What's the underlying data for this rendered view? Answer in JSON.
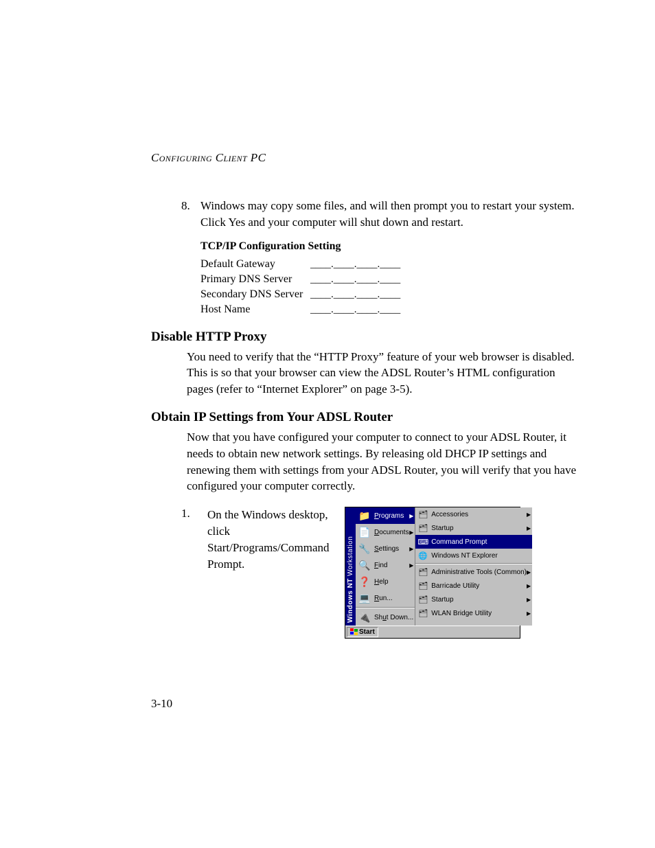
{
  "running_header": "Configuring Client PC",
  "step8": {
    "num": "8.",
    "text": "Windows may copy some files, and will then prompt you to restart your system. Click Yes and your computer will shut down and restart."
  },
  "settings_table": {
    "header": "TCP/IP Configuration Setting",
    "rows": [
      {
        "label": "Default Gateway",
        "value": "____.____.____.____"
      },
      {
        "label": "Primary DNS Server",
        "value": "____.____.____.____"
      },
      {
        "label": "Secondary DNS Server",
        "value": "____.____.____.____"
      },
      {
        "label": "Host Name",
        "value": "____.____.____.____"
      }
    ]
  },
  "section_proxy": {
    "heading": "Disable HTTP Proxy",
    "body": "You need to verify that the “HTTP Proxy” feature of your web browser is disabled. This is so that your browser can view the ADSL Router’s HTML configuration pages (refer to “Internet Explorer” on page 3-5)."
  },
  "section_obtain": {
    "heading": "Obtain IP Settings from Your ADSL Router",
    "body": "Now that you have configured your computer to connect to your ADSL Router, it needs to obtain new network settings. By releasing old DHCP IP settings and renewing them with settings from your ADSL Router, you will verify that you have configured your computer correctly."
  },
  "step1": {
    "num": "1.",
    "text": "On the Windows desktop, click Start/Programs/Command Prompt."
  },
  "start_menu": {
    "banner_bold": "Windows NT",
    "banner_light": "Workstation",
    "main": [
      {
        "icon": "📁",
        "label": "Programs",
        "u": "P",
        "arrow": true,
        "selected": true
      },
      {
        "icon": "📄",
        "label": "Documents",
        "u": "D",
        "arrow": true
      },
      {
        "icon": "🔧",
        "label": "Settings",
        "u": "S",
        "arrow": true
      },
      {
        "icon": "🔍",
        "label": "Find",
        "u": "F",
        "arrow": true
      },
      {
        "icon": "❓",
        "label": "Help",
        "u": "H",
        "arrow": false
      },
      {
        "icon": "💻",
        "label": "Run...",
        "u": "R",
        "arrow": false
      },
      {
        "sep": true
      },
      {
        "icon": "🔌",
        "label": "Shut Down...",
        "u": "u",
        "arrow": false
      }
    ],
    "sub": [
      {
        "icon": "🗂",
        "label": "Accessories",
        "arrow": true
      },
      {
        "icon": "🗂",
        "label": "Startup",
        "arrow": true
      },
      {
        "icon": "⌨",
        "label": "Command Prompt",
        "selected": true
      },
      {
        "icon": "🌐",
        "label": "Windows NT Explorer"
      },
      {
        "sep": true
      },
      {
        "icon": "🗂",
        "label": "Administrative Tools (Common)",
        "arrow": true
      },
      {
        "icon": "🗂",
        "label": "Barricade Utility",
        "arrow": true
      },
      {
        "icon": "🗂",
        "label": "Startup",
        "arrow": true
      },
      {
        "icon": "🗂",
        "label": "WLAN Bridge Utility",
        "arrow": true
      }
    ],
    "start_button": "Start"
  },
  "page_number": "3-10"
}
